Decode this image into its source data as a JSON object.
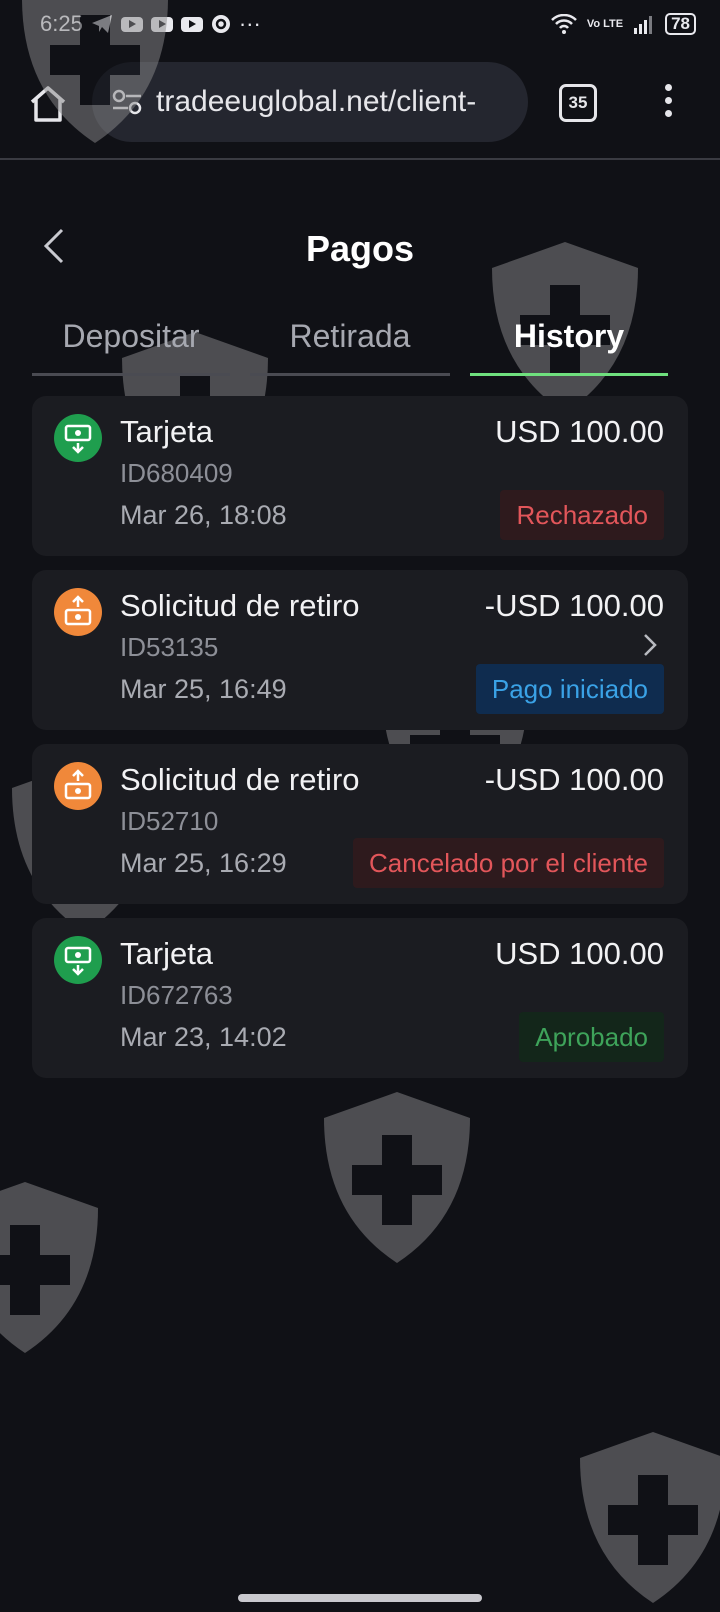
{
  "statusbar": {
    "time": "6:25",
    "more": "···",
    "battery": "78",
    "network": "Vo LTE"
  },
  "browser": {
    "url": "tradeeuglobal.net/client-",
    "tab_count": "35"
  },
  "page": {
    "title": "Pagos"
  },
  "tabs": [
    {
      "label": "Depositar",
      "active": false
    },
    {
      "label": "Retirada",
      "active": false
    },
    {
      "label": "History",
      "active": true
    }
  ],
  "transactions": [
    {
      "type": "deposit",
      "title": "Tarjeta",
      "id": "ID680409",
      "date": "Mar 26, 18:08",
      "amount": "USD 100.00",
      "status": "Rechazado",
      "status_color": "red"
    },
    {
      "type": "withdrawal",
      "title": "Solicitud de retiro",
      "id": "ID53135",
      "date": "Mar 25, 16:49",
      "amount": "-USD 100.00",
      "status": "Pago iniciado",
      "status_color": "blue"
    },
    {
      "type": "withdrawal",
      "title": "Solicitud de retiro",
      "id": "ID52710",
      "date": "Mar 25, 16:29",
      "amount": "-USD 100.00",
      "status": "Cancelado por el cliente",
      "status_color": "red"
    },
    {
      "type": "deposit",
      "title": "Tarjeta",
      "id": "ID672763",
      "date": "Mar 23, 14:02",
      "amount": "USD 100.00",
      "status": "Aprobado",
      "status_color": "green"
    }
  ],
  "colors": {
    "background": "#101116",
    "card": "#1b1c21",
    "accent_tab": "#6fe07e",
    "deposit_icon": "#1f9e4e",
    "withdrawal_icon": "#f0883a"
  }
}
